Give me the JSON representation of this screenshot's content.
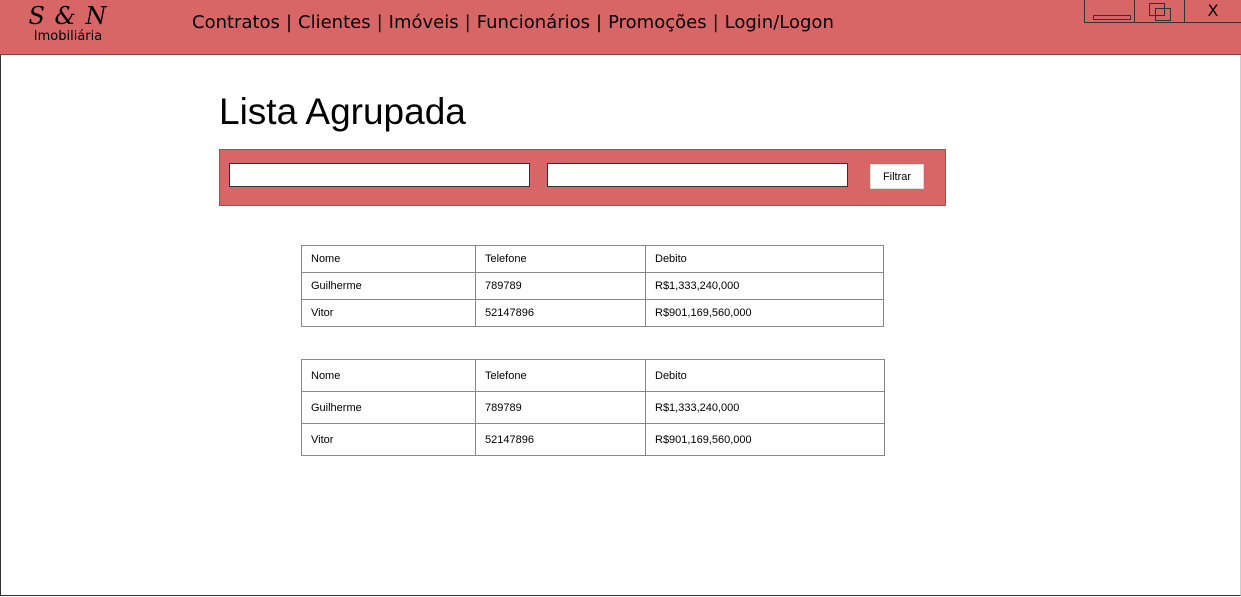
{
  "app": {
    "logo_mark": "S & N",
    "logo_sub": "Imobiliária"
  },
  "nav": {
    "items": [
      "Contratos",
      "Clientes",
      "Imóveis",
      "Funcionários",
      "Promoções",
      "Login/Logon"
    ],
    "separator": "|"
  },
  "window_controls": {
    "minimize_icon": "minimize-icon",
    "maximize_icon": "restore-icon",
    "close_label": "X"
  },
  "page": {
    "title": "Lista Agrupada"
  },
  "filter": {
    "input1_value": "",
    "input2_value": "",
    "button_label": "Filtrar"
  },
  "tables": [
    {
      "headers": [
        "Nome",
        "Telefone",
        "Debito"
      ],
      "rows": [
        [
          "Guilherme",
          "789789",
          "R$1,333,240,000"
        ],
        [
          "Vitor",
          "52147896",
          "R$901,169,560,000"
        ]
      ]
    },
    {
      "headers": [
        "Nome",
        "Telefone",
        "Debito"
      ],
      "rows": [
        [
          "Guilherme",
          "789789",
          "R$1,333,240,000"
        ],
        [
          "Vitor",
          "52147896",
          "R$901,169,560,000"
        ]
      ]
    }
  ],
  "colors": {
    "accent": "#d96666"
  }
}
